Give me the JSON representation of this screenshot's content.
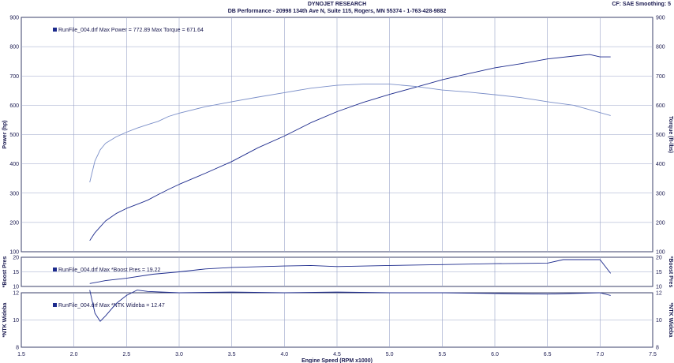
{
  "header": {
    "title": "DYNOJET RESEARCH",
    "subtitle": "DB Performance  - 20998 134th Ave N, Suite 115, Rogers, MN 55374 - 1-763-428-9882",
    "cf": "CF: SAE  Smoothing: 5"
  },
  "colors": {
    "power": "#1c2a8c",
    "torque": "#7a8ec8",
    "boost": "#1c2a8c",
    "wideband": "#1c2a8c",
    "grid": "#9aa3c8",
    "frame": "#3a3f6a",
    "text": "#1a1a50"
  },
  "chart_data": [
    {
      "type": "line",
      "xlabel": "Engine Speed (RPM x1000)",
      "xlim": [
        1.5,
        7.5
      ],
      "x_ticks": [
        "1.5",
        "2.0",
        "2.5",
        "3.0",
        "3.5",
        "4.0",
        "4.5",
        "5.0",
        "5.5",
        "6.0",
        "6.5",
        "7.0",
        "7.5"
      ],
      "ylabel": "Power (hp)",
      "ylabel_right": "Torque (ft-lbs)",
      "ylim": [
        100,
        900
      ],
      "y_ticks": [
        "100",
        "200",
        "300",
        "400",
        "500",
        "600",
        "700",
        "800",
        "900"
      ],
      "legend": "RunFile_004.drf Max Power = 772.89     Max Torque = 671.64",
      "grid": true,
      "series": [
        {
          "name": "Power",
          "x": [
            2.15,
            2.2,
            2.3,
            2.4,
            2.5,
            2.6,
            2.7,
            2.8,
            2.9,
            3.0,
            3.25,
            3.5,
            3.75,
            4.0,
            4.25,
            4.5,
            4.75,
            5.0,
            5.25,
            5.5,
            5.75,
            6.0,
            6.25,
            6.5,
            6.75,
            6.9,
            7.0,
            7.1
          ],
          "values": [
            138,
            165,
            205,
            230,
            248,
            262,
            276,
            295,
            313,
            330,
            368,
            408,
            455,
            495,
            540,
            578,
            610,
            637,
            662,
            687,
            708,
            728,
            742,
            758,
            768,
            773,
            765,
            765
          ]
        },
        {
          "name": "Torque",
          "x": [
            2.15,
            2.2,
            2.25,
            2.3,
            2.4,
            2.5,
            2.6,
            2.7,
            2.8,
            2.9,
            3.0,
            3.25,
            3.5,
            3.75,
            4.0,
            4.25,
            4.5,
            4.75,
            5.0,
            5.25,
            5.5,
            5.75,
            6.0,
            6.25,
            6.5,
            6.75,
            7.0,
            7.1
          ],
          "values": [
            337,
            410,
            448,
            470,
            492,
            508,
            522,
            534,
            545,
            562,
            573,
            595,
            612,
            628,
            643,
            658,
            668,
            672,
            672,
            664,
            652,
            645,
            636,
            626,
            612,
            600,
            575,
            565
          ]
        }
      ]
    },
    {
      "type": "line",
      "ylabel": "*Boost Pres",
      "ylim": [
        10,
        20
      ],
      "y_ticks": [
        "10",
        "15",
        "20"
      ],
      "legend": "RunFile_004.drf Max *Boost Pres = 19.22",
      "grid": true,
      "series": [
        {
          "name": "*Boost Pres",
          "x": [
            2.15,
            2.3,
            2.5,
            2.75,
            3.0,
            3.25,
            3.5,
            4.0,
            4.25,
            4.5,
            5.0,
            5.5,
            6.0,
            6.5,
            6.65,
            7.0,
            7.1
          ],
          "values": [
            11.0,
            12.0,
            12.8,
            14.2,
            15.0,
            16.0,
            16.5,
            17.0,
            17.2,
            16.8,
            17.2,
            17.5,
            17.8,
            18.0,
            19.2,
            19.2,
            14.5
          ]
        }
      ]
    },
    {
      "type": "line",
      "ylabel": "*NTK Wideba",
      "ylim": [
        8,
        12
      ],
      "y_ticks": [
        "8",
        "10",
        "12"
      ],
      "legend": "RunFile_004.drf Max *NTK Wideba = 12.47",
      "grid": true,
      "series": [
        {
          "name": "*NTK Wideba",
          "x": [
            2.15,
            2.2,
            2.25,
            2.3,
            2.4,
            2.5,
            2.6,
            2.7,
            3.0,
            3.5,
            4.0,
            4.5,
            5.0,
            5.5,
            6.0,
            6.5,
            7.0,
            7.1
          ],
          "values": [
            12.2,
            10.5,
            9.9,
            10.3,
            11.2,
            11.8,
            12.2,
            12.1,
            12.0,
            12.05,
            12.0,
            12.05,
            12.0,
            12.0,
            11.95,
            11.9,
            12.0,
            11.8
          ]
        }
      ]
    }
  ]
}
